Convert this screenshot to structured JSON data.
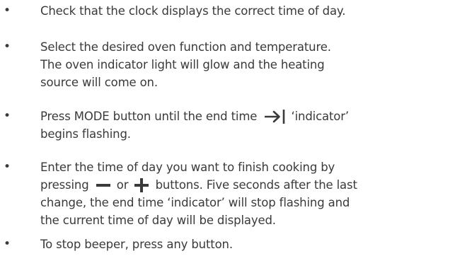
{
  "steps": [
    {
      "lines": [
        "Check that the clock displays the correct time of day."
      ]
    },
    {
      "lines": [
        "Select the desired oven function and temperature.",
        "The oven indicator light will glow and the heating",
        "source will come on."
      ]
    },
    {
      "line1_before": "Press MODE button until the end time",
      "line1_after": "‘indicator’",
      "line2": "begins flashing.",
      "symbol": "arrow-right-to-bar-icon"
    },
    {
      "line1": "Enter the time of day you want to finish cooking by",
      "line2_a": "pressing",
      "line2_b": "or",
      "line2_c": "buttons. Five seconds after the last",
      "line3": "change, the end time ‘indicator’ will stop flashing and",
      "line4": "the current time of day will be displayed.",
      "symbols": [
        "minus-icon",
        "plus-icon"
      ]
    },
    {
      "lines": [
        "To stop beeper, press any button."
      ]
    }
  ],
  "bullet_char": "•",
  "colors": {
    "text": "#3a3a3a"
  }
}
